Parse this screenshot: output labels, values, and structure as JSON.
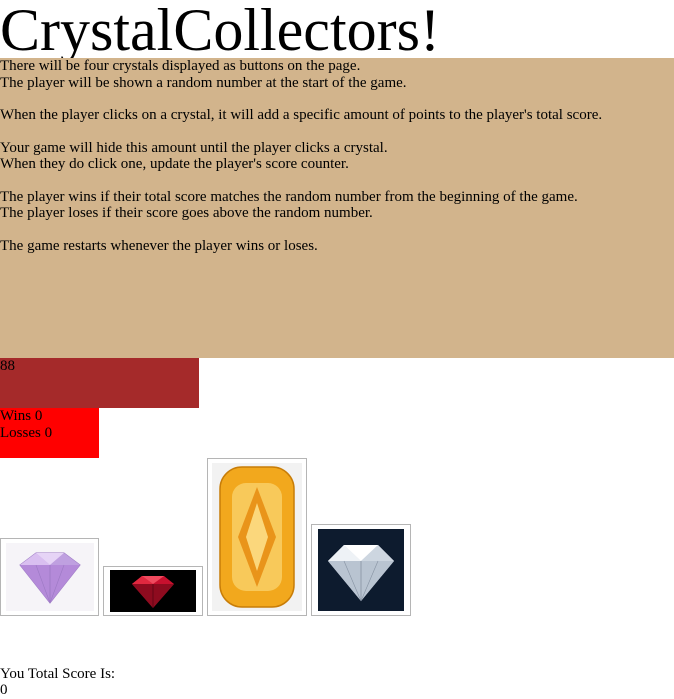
{
  "title": "CrystalCollectors!",
  "instructions": [
    [
      "There will be four crystals displayed as buttons on the page.",
      "The player will be shown a random number at the start of the game."
    ],
    [
      "When the player clicks on a crystal, it will add a specific amount of points to the player's total score."
    ],
    [
      "Your game will hide this amount until the player clicks a crystal.",
      "When they do click one, update the player's score counter."
    ],
    [
      "The player wins if their total score matches the random number from the beginning of the game.",
      "The player loses if their score goes above the random number."
    ],
    [
      "The game restarts whenever the player wins or loses."
    ]
  ],
  "target_number": "88",
  "wins_label": "Wins",
  "wins_value": "0",
  "losses_label": "Losses",
  "losses_value": "0",
  "crystals": [
    {
      "name": "purple crystal",
      "color": "#c9a6e8"
    },
    {
      "name": "red crystal",
      "color": "#c8102e"
    },
    {
      "name": "orange crystal",
      "color": "#f2a81d"
    },
    {
      "name": "clear diamond",
      "color": "#dfe6ee"
    }
  ],
  "score_label": "You Total Score Is:",
  "score_value": "0"
}
